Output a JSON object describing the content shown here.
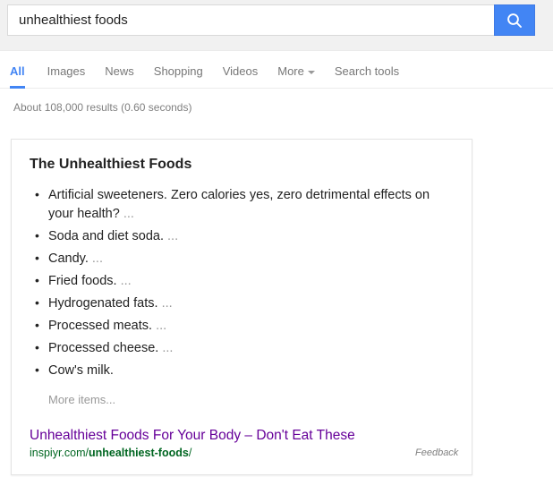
{
  "search": {
    "query": "unhealthiest foods",
    "placeholder": "Search",
    "button_icon": "search-icon",
    "button_color": "#4285f4"
  },
  "nav": {
    "tabs": [
      {
        "label": "All",
        "active": true
      },
      {
        "label": "Images",
        "active": false
      },
      {
        "label": "News",
        "active": false
      },
      {
        "label": "Shopping",
        "active": false
      },
      {
        "label": "Videos",
        "active": false
      },
      {
        "label": "More",
        "active": false,
        "has_caret": true
      },
      {
        "label": "Search tools",
        "active": false
      }
    ],
    "active_color": "#4285f4"
  },
  "result_stats": "About 108,000 results (0.60 seconds)",
  "answer_card": {
    "title": "The Unhealthiest Foods",
    "items": [
      {
        "text": "Artificial sweeteners. Zero calories yes, zero detrimental effects on your health?",
        "ellipsis": "..."
      },
      {
        "text": "Soda and diet soda.",
        "ellipsis": "..."
      },
      {
        "text": "Candy.",
        "ellipsis": "..."
      },
      {
        "text": "Fried foods.",
        "ellipsis": "..."
      },
      {
        "text": "Hydrogenated fats.",
        "ellipsis": "..."
      },
      {
        "text": "Processed meats.",
        "ellipsis": "..."
      },
      {
        "text": "Processed cheese.",
        "ellipsis": "..."
      },
      {
        "text": "Cow's milk.",
        "ellipsis": ""
      }
    ],
    "more_items_label": "More items...",
    "source_title": "Unhealthiest Foods For Your Body – Don't Eat These",
    "source_url_prefix": "inspiyr.com/",
    "source_url_bold": "unhealthiest-foods",
    "source_url_suffix": "/",
    "title_color": "#660099",
    "url_color": "#006621"
  },
  "feedback_label": "Feedback"
}
